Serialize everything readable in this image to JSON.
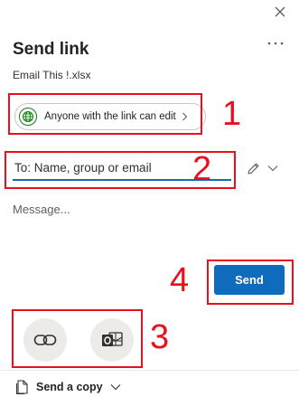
{
  "header": {
    "title": "Send link",
    "filename": "Email This !.xlsx",
    "close_icon": "close-icon",
    "more_icon": "more-options-icon"
  },
  "permission": {
    "label": "Anyone with the link can edit",
    "icon": "globe-icon",
    "chevron_icon": "chevron-right-icon"
  },
  "to_field": {
    "value": "",
    "placeholder": "To: Name, group or email",
    "pencil_icon": "pencil-icon",
    "chevron_icon": "chevron-down-icon"
  },
  "message": {
    "value": "",
    "placeholder": "Message..."
  },
  "send_button": {
    "label": "Send"
  },
  "share_options": [
    {
      "icon": "link-icon"
    },
    {
      "icon": "outlook-icon"
    }
  ],
  "send_copy": {
    "label": "Send a copy",
    "icon": "document-icon",
    "chevron_icon": "chevron-down-icon"
  },
  "annotations": [
    "1",
    "2",
    "3",
    "4"
  ],
  "colors": {
    "accent": "#0f6cbd",
    "annotation": "#e8101c",
    "globe": "#107c10",
    "round_button_bg": "#edebe9"
  }
}
